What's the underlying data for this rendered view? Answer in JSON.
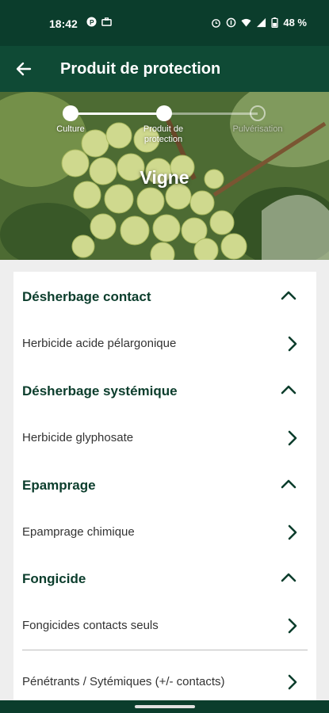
{
  "status_bar": {
    "time": "18:42",
    "battery": "48 %",
    "left_icons": [
      "p-badge-icon",
      "briefcase-icon"
    ],
    "right_icons": [
      "alarm-icon",
      "data-saver-icon",
      "wifi-icon",
      "signal-icon",
      "battery-icon"
    ]
  },
  "app_bar": {
    "title": "Produit de protection",
    "back_icon": "arrow-left-icon"
  },
  "stepper": {
    "steps": [
      {
        "label": "Culture",
        "state": "done"
      },
      {
        "label": "Produit de protection",
        "state": "current"
      },
      {
        "label": "Pulvérisation",
        "state": "todo"
      }
    ]
  },
  "hero": {
    "title": "Vigne"
  },
  "sections": [
    {
      "title": "Désherbage contact",
      "items": [
        "Herbicide acide pélargonique"
      ]
    },
    {
      "title": "Désherbage systémique",
      "items": [
        "Herbicide glyphosate"
      ]
    },
    {
      "title": "Epamprage",
      "items": [
        "Epamprage chimique"
      ]
    },
    {
      "title": "Fongicide",
      "items": [
        "Fongicides contacts seuls",
        "Pénétrants / Sytémiques (+/- contacts)"
      ]
    }
  ],
  "colors": {
    "primary": "#0f4a35",
    "dark": "#0b3d2c",
    "text": "#333333"
  }
}
